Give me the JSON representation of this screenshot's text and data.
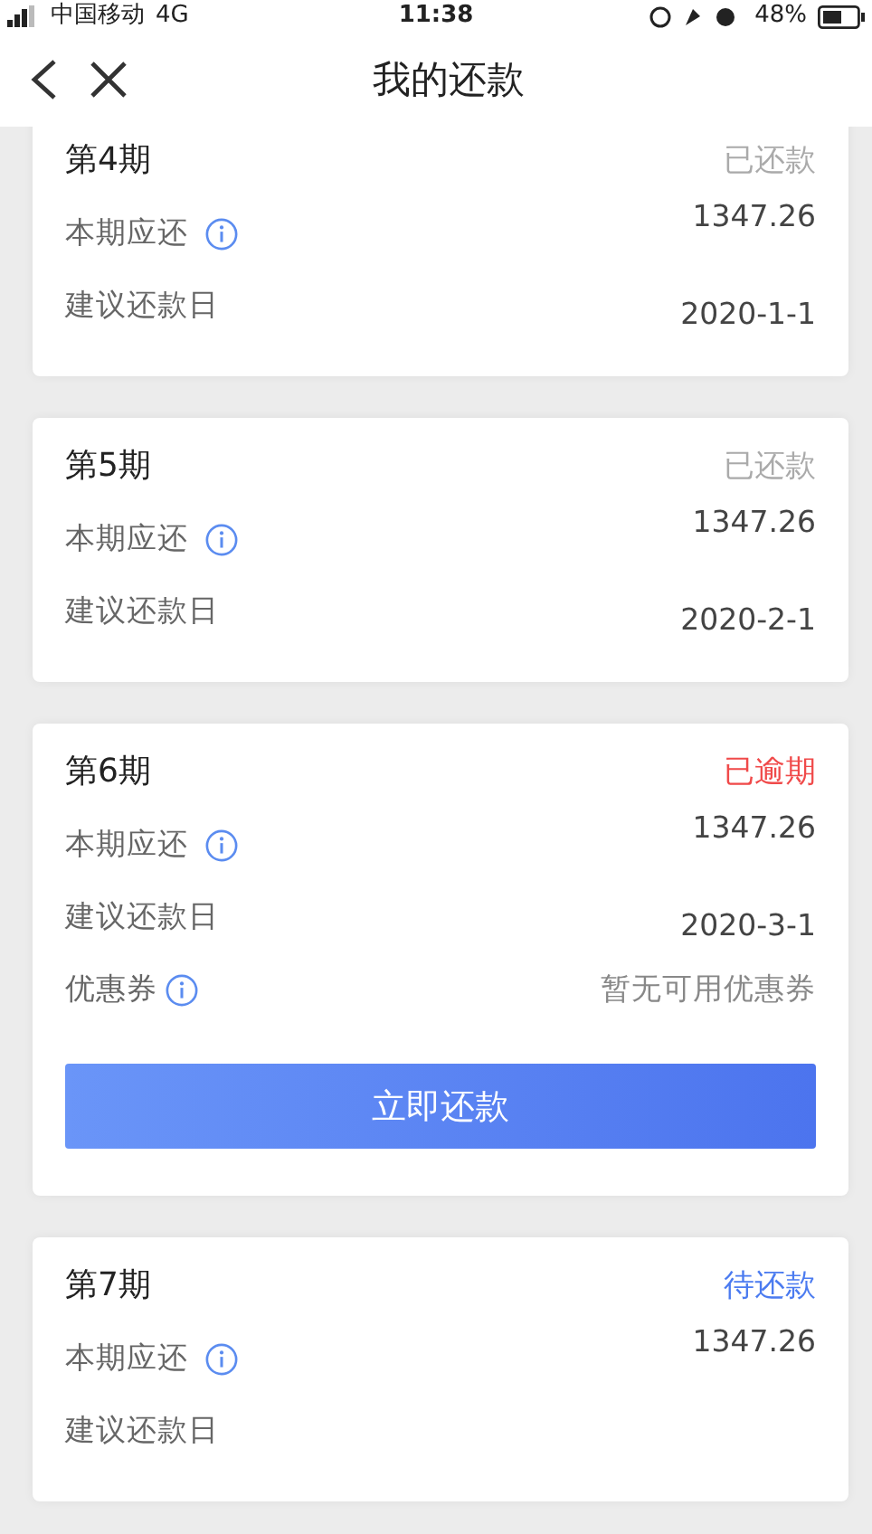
{
  "status_bar": {
    "carrier": "中国移动",
    "network": "4G",
    "time": "11:38",
    "battery": "48%"
  },
  "nav": {
    "title": "我的还款"
  },
  "cards": [
    {
      "title": "第4期",
      "status": "已还款",
      "kind": "paid",
      "rows": [
        {
          "kind": "amount",
          "label": "本期应还",
          "value": "1347.26"
        },
        {
          "kind": "date",
          "label": "建议还款日",
          "value": "2020-1-1"
        }
      ]
    },
    {
      "title": "第5期",
      "status": "已还款",
      "kind": "paid",
      "rows": [
        {
          "kind": "amount",
          "label": "本期应还",
          "value": "1347.26"
        },
        {
          "kind": "date",
          "label": "建议还款日",
          "value": "2020-2-1"
        }
      ]
    },
    {
      "title": "第6期",
      "status": "已逾期",
      "kind": "overdue",
      "rows": [
        {
          "kind": "amount",
          "label": "本期应还",
          "value": "1347.26"
        },
        {
          "kind": "date",
          "label": "建议还款日",
          "value": "2020-3-1"
        },
        {
          "kind": "coupon",
          "label": "优惠券",
          "value": "暂无可用优惠券"
        }
      ],
      "button": "立即还款"
    },
    {
      "title": "第7期",
      "status": "待还款",
      "kind": "pending",
      "rows": [
        {
          "kind": "amount",
          "label": "本期应还",
          "value": "1347.26"
        },
        {
          "kind": "date",
          "label": "建议还款日"
        }
      ]
    }
  ]
}
